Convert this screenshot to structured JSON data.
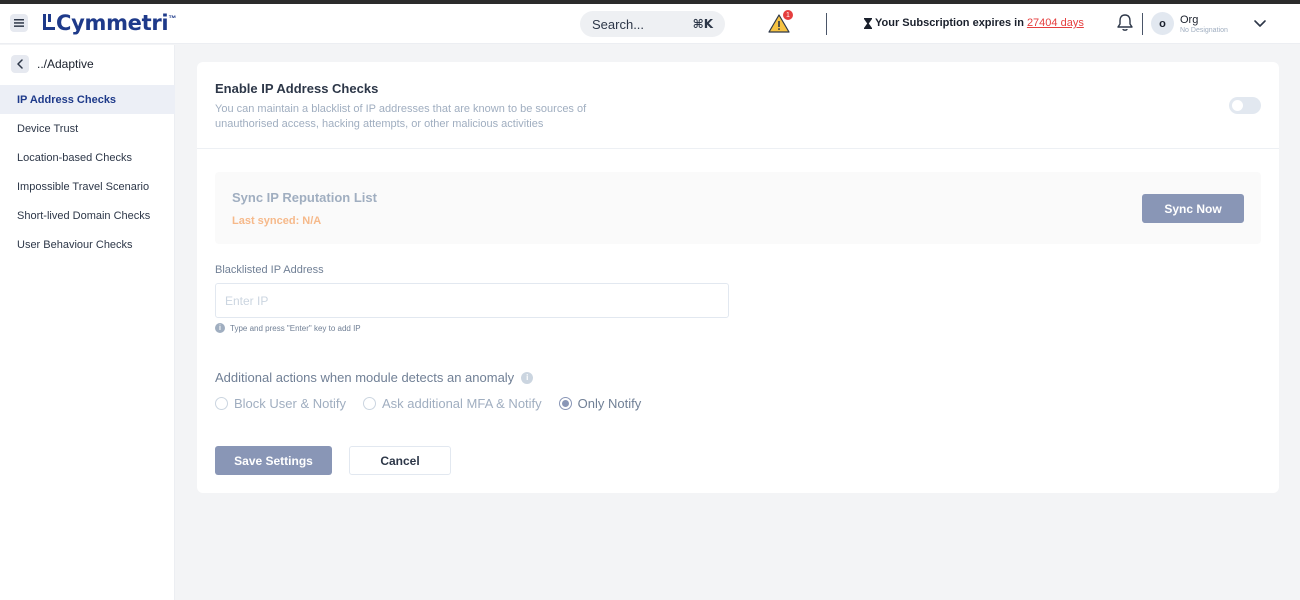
{
  "brand": {
    "name": "Cymmetri",
    "tm": "™"
  },
  "header": {
    "search_label": "Search...",
    "search_shortcut": "⌘K",
    "alert_count": "1",
    "subscription_prefix": "Your Subscription expires in",
    "subscription_days": "27404 days",
    "avatar_initial": "o",
    "org_name": "Org",
    "org_designation": "No Designation"
  },
  "sidebar": {
    "back_label": "../Adaptive",
    "items": [
      {
        "label": "IP Address Checks",
        "active": true
      },
      {
        "label": "Device Trust"
      },
      {
        "label": "Location-based Checks"
      },
      {
        "label": "Impossible Travel Scenario"
      },
      {
        "label": "Short-lived Domain Checks"
      },
      {
        "label": "User Behaviour Checks"
      }
    ]
  },
  "main": {
    "enable_title": "Enable IP Address Checks",
    "enable_desc": "You can maintain a blacklist of IP addresses that are known to be sources of unauthorised access, hacking attempts, or other malicious activities",
    "toggle_on": false,
    "sync": {
      "title": "Sync IP Reputation List",
      "last_synced": "Last synced: N/A",
      "button": "Sync Now"
    },
    "blacklist": {
      "label": "Blacklisted IP Address",
      "placeholder": "Enter IP",
      "hint": "Type and press \"Enter\" key to add IP"
    },
    "actions": {
      "title": "Additional actions when module detects an anomaly",
      "options": [
        {
          "label": "Block User & Notify",
          "checked": false
        },
        {
          "label": "Ask additional MFA & Notify",
          "checked": false
        },
        {
          "label": "Only Notify",
          "checked": true
        }
      ]
    },
    "buttons": {
      "save": "Save Settings",
      "cancel": "Cancel"
    }
  },
  "colors": {
    "brand": "#1e3a8a",
    "primary_button": "#8996b6",
    "danger": "#e53e3e",
    "warning": "#f6b98a"
  }
}
